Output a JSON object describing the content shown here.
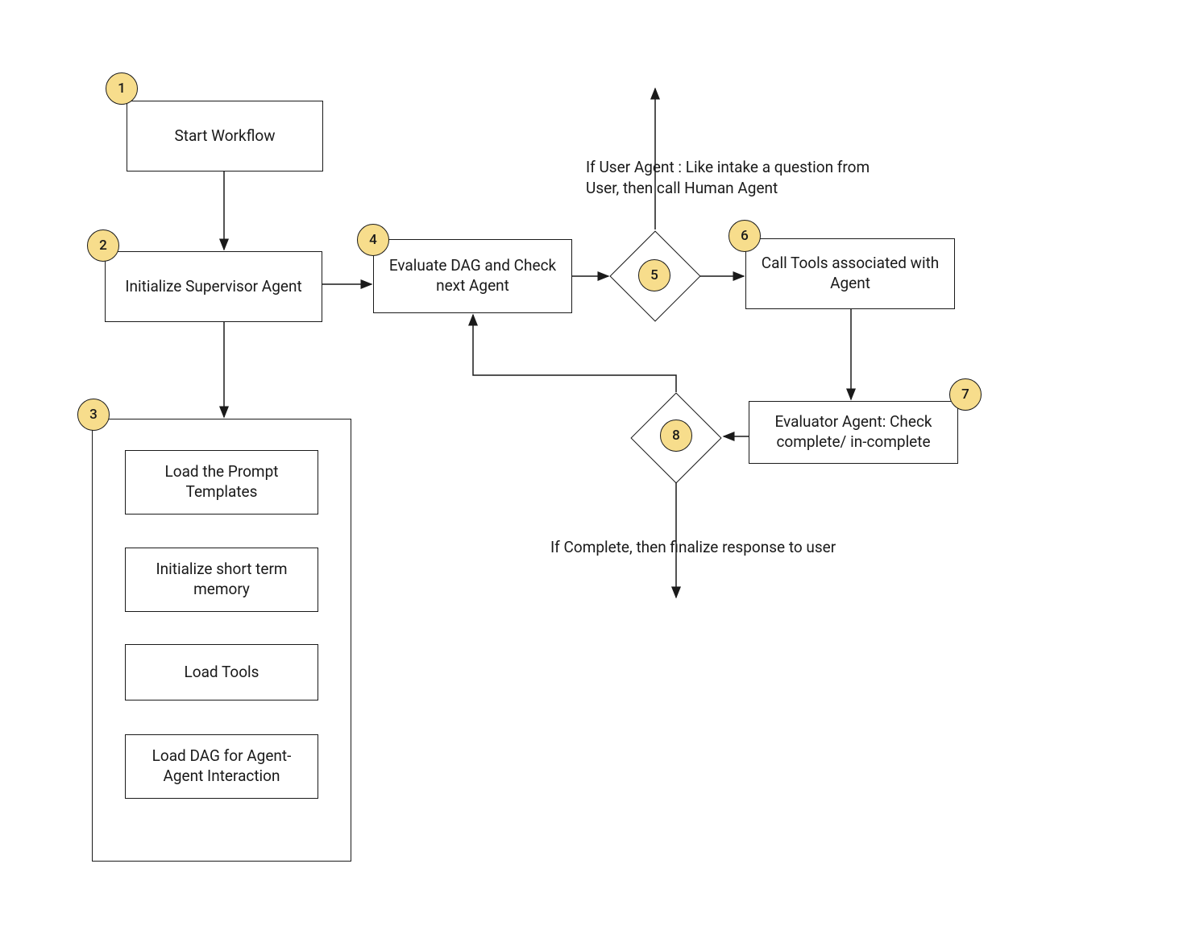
{
  "nodes": {
    "n1": {
      "num": "1",
      "label": "Start Workflow"
    },
    "n2": {
      "num": "2",
      "label": "Initialize Supervisor Agent"
    },
    "n3": {
      "num": "3"
    },
    "n3_items": [
      "Load the Prompt Templates",
      "Initialize short term memory",
      "Load Tools",
      "Load DAG for Agent-Agent Interaction"
    ],
    "n4": {
      "num": "4",
      "label": "Evaluate DAG and Check next Agent"
    },
    "n5": {
      "num": "5"
    },
    "n6": {
      "num": "6",
      "label": "Call Tools associated with Agent"
    },
    "n7": {
      "num": "7",
      "label": "Evaluator Agent: Check complete/ in-complete"
    },
    "n8": {
      "num": "8"
    }
  },
  "annotations": {
    "a1": "If User Agent : Like intake a question from User, then call Human Agent",
    "a2": "If Complete, then finalize response to user"
  }
}
